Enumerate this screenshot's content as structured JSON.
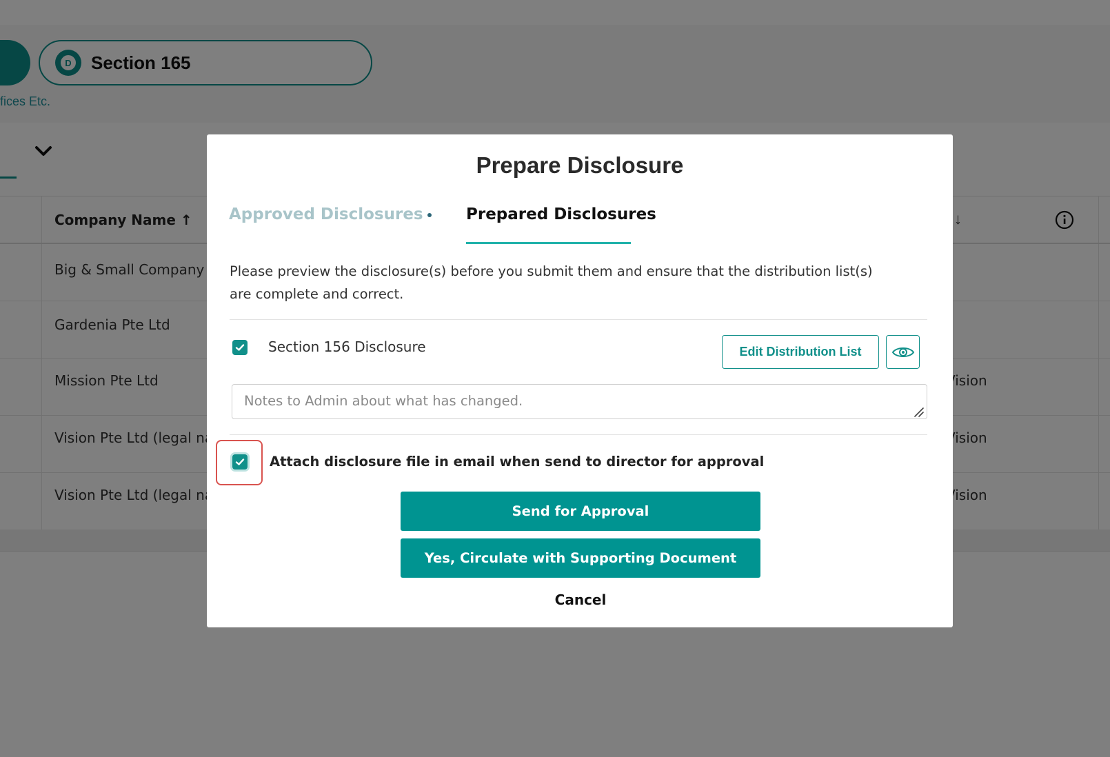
{
  "background": {
    "section_pill": {
      "badge_letter": "D",
      "title": "Section 165"
    },
    "subtitle_fragment": "fices Etc.",
    "table": {
      "header": {
        "company_name": "Company Name ↑",
        "sort_arrow": "↓"
      },
      "rows": [
        {
          "company": "Big & Small Company",
          "right": ""
        },
        {
          "company": "Gardenia Pte Ltd",
          "right": ""
        },
        {
          "company": "Mission Pte Ltd",
          "right": "Vision"
        },
        {
          "company": "Vision Pte Ltd (legal na",
          "right": "Vision"
        },
        {
          "company": "Vision Pte Ltd (legal na",
          "right": "Vision"
        }
      ]
    }
  },
  "modal": {
    "title": "Prepare Disclosure",
    "tabs": [
      {
        "label": "Approved Disclosures",
        "active": false
      },
      {
        "label": "Prepared Disclosures",
        "active": true
      }
    ],
    "instructions": "Please preview the disclosure(s) before you submit them and ensure that the distribution list(s) are complete and correct.",
    "disclosure_item": {
      "label": "Section 156 Disclosure",
      "checked": true,
      "edit_button": "Edit Distribution List",
      "preview_icon": "eye-icon"
    },
    "notes": {
      "placeholder": "Notes to Admin about what has changed.",
      "value": ""
    },
    "attach_option": {
      "label": "Attach disclosure file in email when send to director for approval",
      "checked": true
    },
    "buttons": {
      "send": "Send for Approval",
      "circulate": "Yes, Circulate with Supporting Document",
      "cancel": "Cancel"
    }
  },
  "colors": {
    "accent": "#009491",
    "accent_dark": "#11908a",
    "tab_inactive": "#a8c4c9",
    "highlight": "#d9534f",
    "overlay": "rgba(0,0,0,0.5)"
  }
}
